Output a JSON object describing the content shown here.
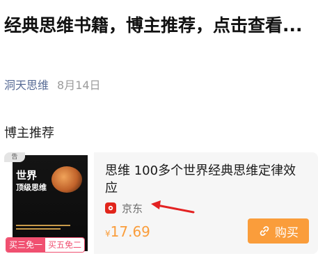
{
  "article": {
    "title": "经典思维书籍，博主推荐，点击查看...",
    "account": "洞天思维",
    "date": "8月14日",
    "section_label": "博主推荐"
  },
  "product": {
    "ad_mark": "告",
    "title": "思维 100多个世界经典思维定律效应",
    "store": "京东",
    "currency": "¥",
    "price": "17.69",
    "buy_label": "购买",
    "promo": [
      "买三免一",
      "买五免二"
    ],
    "cover": {
      "line1": "世界",
      "line2": "顶级思维"
    }
  },
  "colors": {
    "accent": "#fa9d3b",
    "link": "#576b95",
    "store_brand": "#e1251b",
    "promo": "#f05070"
  }
}
